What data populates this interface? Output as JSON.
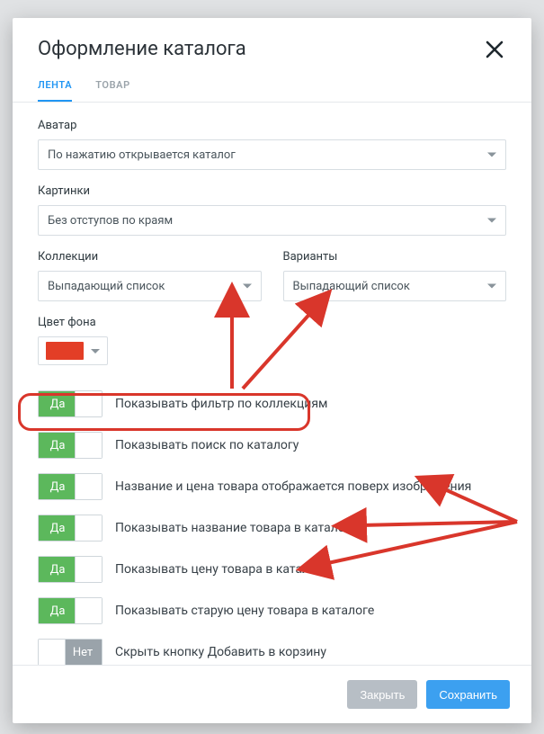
{
  "modal": {
    "title": "Оформление каталога",
    "tabs": {
      "feed": "ЛЕНТА",
      "product": "ТОВАР"
    },
    "fields": {
      "avatar": {
        "label": "Аватар",
        "value": "По нажатию открывается каталог"
      },
      "images": {
        "label": "Картинки",
        "value": "Без отступов по краям"
      },
      "collections": {
        "label": "Коллекции",
        "value": "Выпадающий список"
      },
      "variants": {
        "label": "Варианты",
        "value": "Выпадающий список"
      },
      "bgcolor": {
        "label": "Цвет фона",
        "value": "#e33e26"
      }
    },
    "toggles": [
      {
        "state": "on",
        "on_text": "Да",
        "label": "Показывать фильтр по коллекциям"
      },
      {
        "state": "on",
        "on_text": "Да",
        "label": "Показывать поиск по каталогу"
      },
      {
        "state": "on",
        "on_text": "Да",
        "label": "Название и цена товара отображается поверх изображения"
      },
      {
        "state": "on",
        "on_text": "Да",
        "label": "Показывать название товара в каталоге"
      },
      {
        "state": "on",
        "on_text": "Да",
        "label": "Показывать цену товара в каталоге"
      },
      {
        "state": "on",
        "on_text": "Да",
        "label": "Показывать старую цену товара в каталоге"
      },
      {
        "state": "off",
        "off_text": "Нет",
        "label": "Скрыть кнопку Добавить в корзину"
      }
    ],
    "footer": {
      "close": "Закрыть",
      "save": "Сохранить"
    }
  },
  "annotations": {
    "highlight_color": "#d9362b"
  }
}
